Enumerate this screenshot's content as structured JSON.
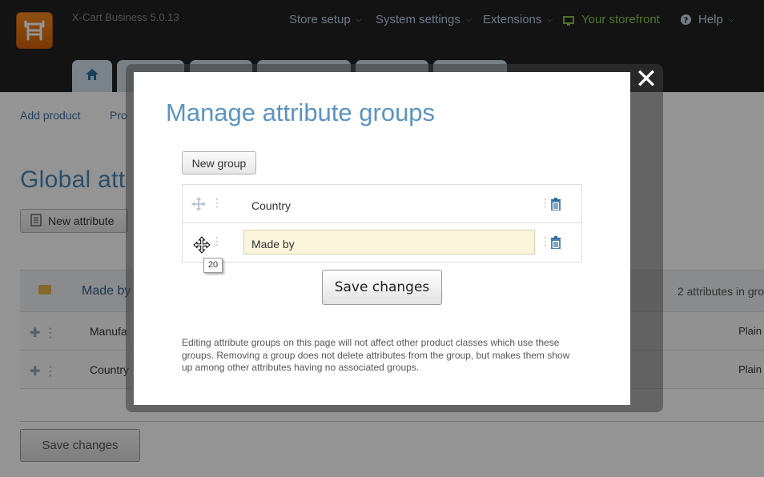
{
  "header": {
    "version": "X-Cart Business 5.0.13",
    "nav": [
      {
        "label": "Store setup"
      },
      {
        "label": "System settings"
      },
      {
        "label": "Extensions"
      },
      {
        "label": "Your storefront"
      },
      {
        "label": "Help"
      }
    ]
  },
  "page": {
    "subnav": [
      "Add product",
      "Pro"
    ],
    "title": "Global att",
    "new_attribute_label": "New attribute",
    "group": {
      "name": "Made by",
      "count": "2 attributes in gro"
    },
    "attributes": [
      {
        "name": "Manufa",
        "type": "Plain"
      },
      {
        "name": "Country",
        "type": "Plain"
      }
    ],
    "save_label": "Save changes"
  },
  "modal": {
    "title": "Manage attribute groups",
    "new_group_label": "New group",
    "groups": [
      {
        "name": "Country"
      },
      {
        "name": "Made by"
      }
    ],
    "tooltip": "20",
    "save_label": "Save changes",
    "note": "Editing attribute groups on this page will not affect other product classes which use these groups. Removing a group does not delete attributes from the group, but makes them show up among other attributes having no associated groups."
  },
  "colors": {
    "accent": "#5b93c0",
    "header_bg": "#222222",
    "storefront": "#86c64b",
    "input_highlight": "#fbf5dd"
  }
}
